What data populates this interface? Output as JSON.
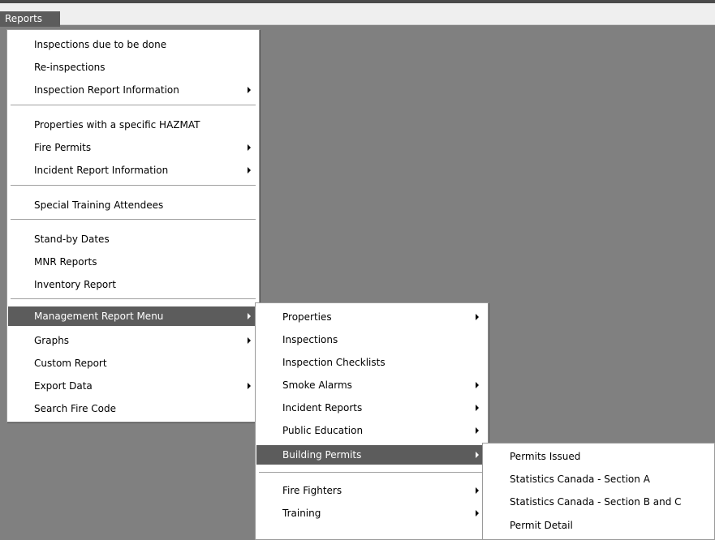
{
  "menubar": {
    "reports_label": "Reports"
  },
  "reports_menu": {
    "items": [
      {
        "label": "Inspections due to be done"
      },
      {
        "label": "Re-inspections"
      },
      {
        "label": "Inspection Report Information"
      },
      {
        "label": "Properties with a specific HAZMAT"
      },
      {
        "label": "Fire Permits"
      },
      {
        "label": "Incident Report Information"
      },
      {
        "label": "Special Training Attendees"
      },
      {
        "label": "Stand-by Dates"
      },
      {
        "label": "MNR Reports"
      },
      {
        "label": "Inventory Report"
      },
      {
        "label": "Management Report Menu"
      },
      {
        "label": "Graphs"
      },
      {
        "label": "Custom Report"
      },
      {
        "label": "Export Data"
      },
      {
        "label": "Search Fire Code"
      }
    ]
  },
  "management_menu": {
    "items": [
      {
        "label": "Properties"
      },
      {
        "label": "Inspections"
      },
      {
        "label": "Inspection Checklists"
      },
      {
        "label": "Smoke Alarms"
      },
      {
        "label": "Incident Reports"
      },
      {
        "label": "Public Education"
      },
      {
        "label": "Building Permits"
      },
      {
        "label": "Fire Fighters"
      },
      {
        "label": "Training"
      }
    ]
  },
  "permits_menu": {
    "items": [
      {
        "label": "Permits Issued"
      },
      {
        "label": "Statistics Canada - Section A"
      },
      {
        "label": "Statistics Canada - Section B and C"
      },
      {
        "label": "Permit Detail"
      }
    ]
  }
}
